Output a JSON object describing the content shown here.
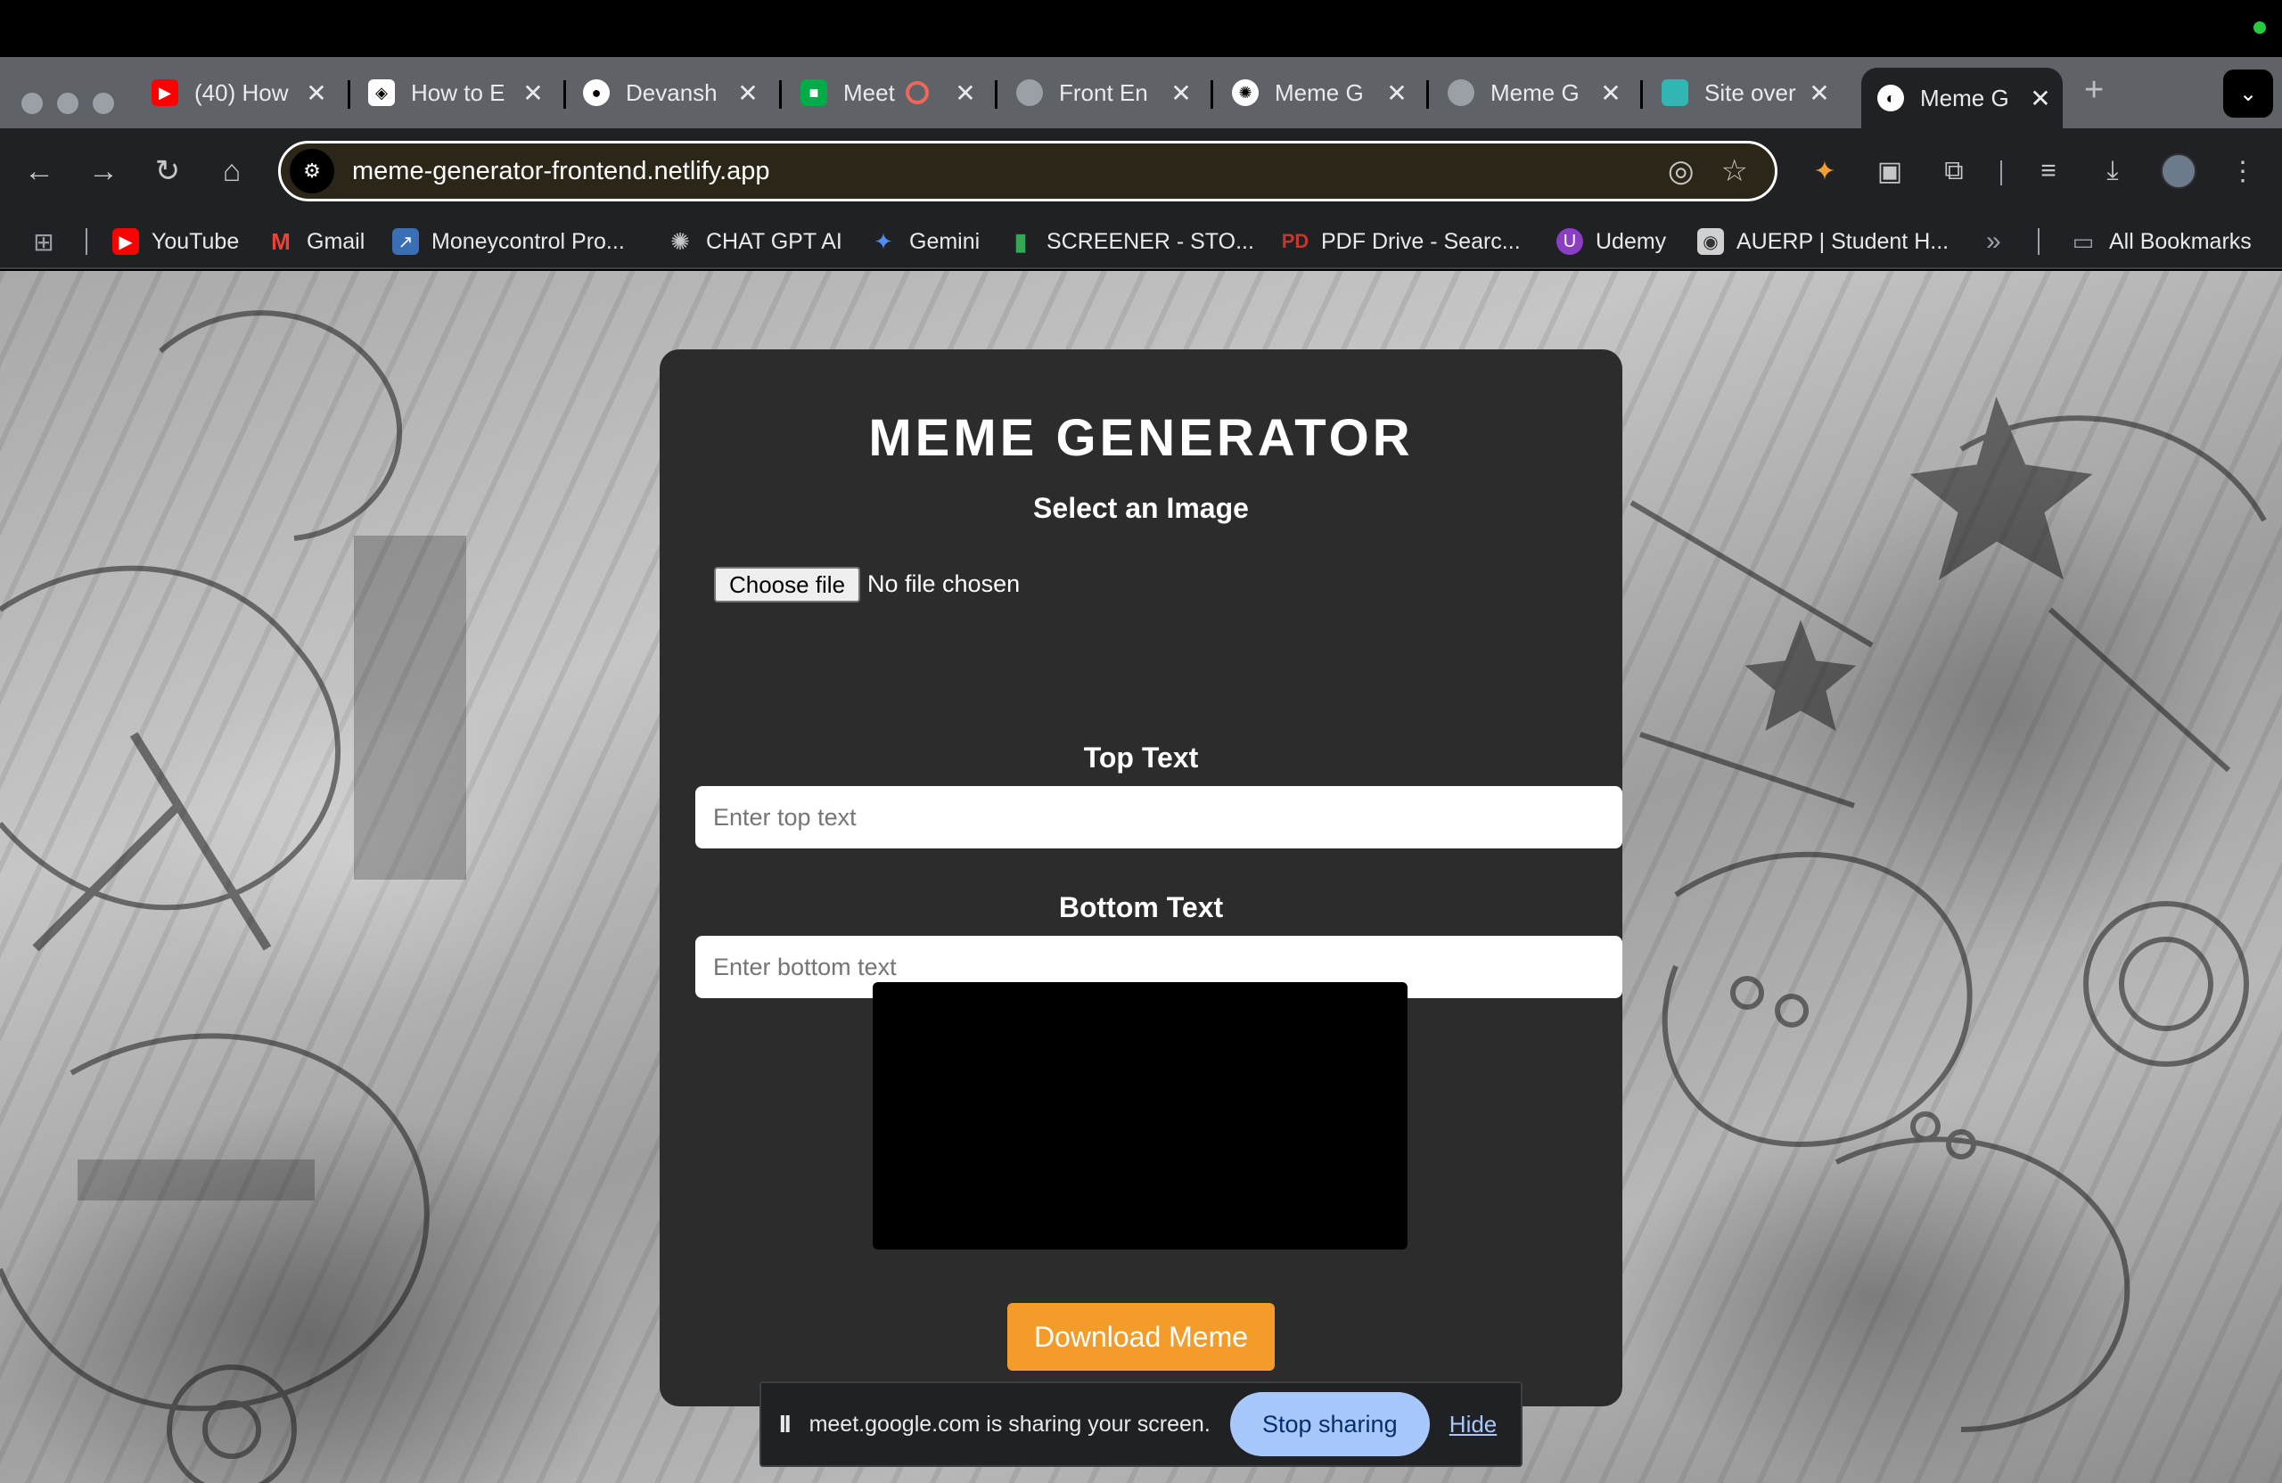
{
  "browser": {
    "tabs": [
      {
        "title": "(40) How",
        "icon": "youtube-icon",
        "color": "#ff0000"
      },
      {
        "title": "How to E",
        "icon": "codepen-icon",
        "color": "#ffffff"
      },
      {
        "title": "Devansh",
        "icon": "github-icon",
        "color": "#ffffff"
      },
      {
        "title": "Meet",
        "icon": "google-meet-icon",
        "color": "#00ac47"
      },
      {
        "title": "Front En",
        "icon": "globe-icon",
        "color": "#9aa0a6"
      },
      {
        "title": "Meme G",
        "icon": "openai-icon",
        "color": "#ffffff"
      },
      {
        "title": "Meme G",
        "icon": "globe-icon",
        "color": "#9aa0a6"
      },
      {
        "title": "Site over",
        "icon": "netlify-icon",
        "color": "#32b6b4"
      },
      {
        "title": "Meme G",
        "icon": "globe-icon",
        "color": "#ffffff",
        "active": true
      }
    ],
    "tab_close_glyph": "✕",
    "new_tab_glyph": "+",
    "url": "meme-generator-frontend.netlify.app"
  },
  "bookmarks": [
    {
      "label": "YouTube",
      "icon": "youtube-icon"
    },
    {
      "label": "Gmail",
      "icon": "gmail-icon"
    },
    {
      "label": "Moneycontrol Pro...",
      "icon": "moneycontrol-icon"
    },
    {
      "label": "CHAT GPT AI",
      "icon": "openai-icon"
    },
    {
      "label": "Gemini",
      "icon": "gemini-icon"
    },
    {
      "label": "SCREENER - STO...",
      "icon": "screener-icon"
    },
    {
      "label": "PDF Drive - Searc...",
      "icon": "pdf-drive-icon"
    },
    {
      "label": "Udemy",
      "icon": "udemy-icon"
    },
    {
      "label": "AUERP | Student H...",
      "icon": "auerp-icon"
    }
  ],
  "bookmarks_overflow": "»",
  "all_bookmarks_label": "All Bookmarks",
  "app": {
    "title": "MEME GENERATOR",
    "select_image_label": "Select an Image",
    "choose_file_label": "Choose file",
    "no_file_text": "No file chosen",
    "top_text_label": "Top Text",
    "top_text_placeholder": "Enter top text",
    "bottom_text_label": "Bottom Text",
    "bottom_text_placeholder": "Enter bottom text",
    "download_label": "Download Meme",
    "accent_color": "#f39c2a"
  },
  "share_bar": {
    "pause_glyph": "II",
    "message": "meet.google.com is sharing your screen.",
    "stop_label": "Stop sharing",
    "hide_label": "Hide"
  }
}
